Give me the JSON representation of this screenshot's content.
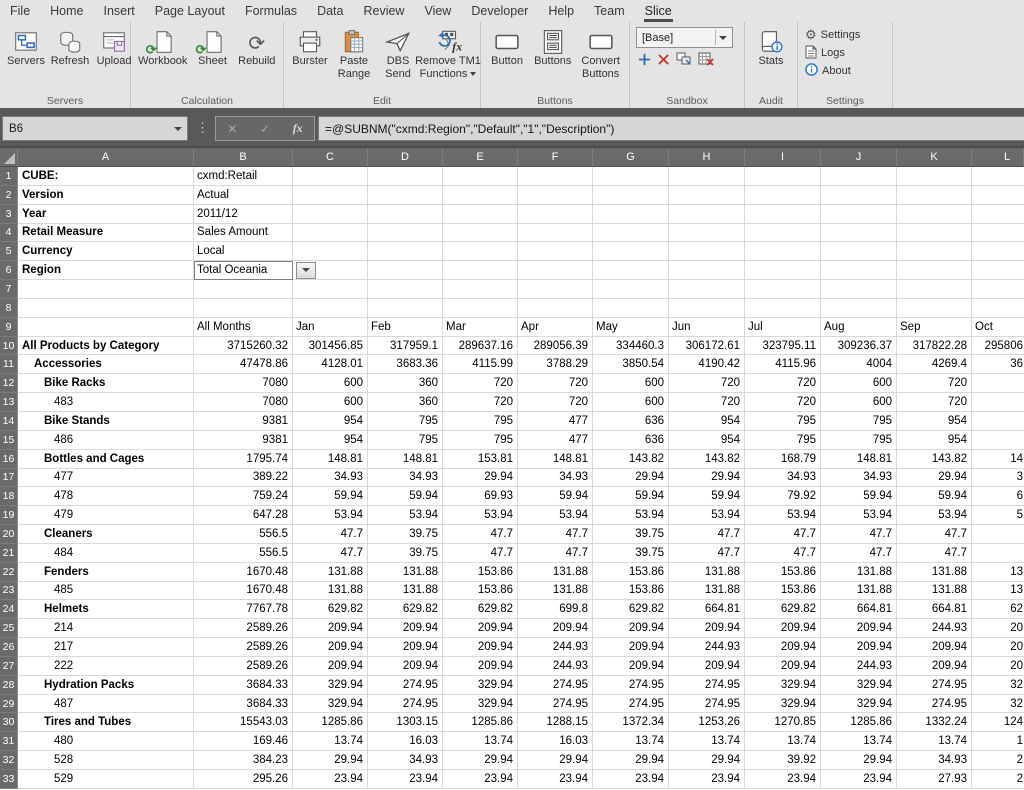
{
  "ribbon": {
    "tabs": [
      "File",
      "Home",
      "Insert",
      "Page Layout",
      "Formulas",
      "Data",
      "Review",
      "View",
      "Developer",
      "Help",
      "Team",
      "Slice"
    ],
    "active_tab": "Slice",
    "groups": {
      "servers": {
        "label": "Servers",
        "buttons": [
          {
            "label1": "Servers"
          },
          {
            "label1": "Refresh"
          },
          {
            "label1": "Upload"
          }
        ]
      },
      "calculation": {
        "label": "Calculation",
        "buttons": [
          {
            "label1": "Workbook"
          },
          {
            "label1": "Sheet"
          },
          {
            "label1": "Rebuild"
          }
        ]
      },
      "edit": {
        "label": "Edit",
        "buttons": [
          {
            "label1": "Burster"
          },
          {
            "label1": "Paste",
            "label2": "Range"
          },
          {
            "label1": "DBS",
            "label2": "Send"
          },
          {
            "label1": "Remove TM1",
            "label2": "Functions"
          }
        ]
      },
      "buttons": {
        "label": "Buttons",
        "buttons": [
          {
            "label1": "Button"
          },
          {
            "label1": "Buttons"
          },
          {
            "label1": "Convert",
            "label2": "Buttons"
          }
        ]
      },
      "sandbox": {
        "label": "Sandbox",
        "combo_value": "[Base]"
      },
      "audit": {
        "label": "Audit",
        "buttons": [
          {
            "label1": "Stats"
          }
        ]
      },
      "settings": {
        "label": "Settings",
        "items": [
          "Settings",
          "Logs",
          "About"
        ]
      }
    }
  },
  "formula_bar": {
    "name_box": "B6",
    "cancel_glyph": "✕",
    "enter_glyph": "✓",
    "fx_glyph": "fx",
    "handle_glyph": "⋮",
    "formula": "=@SUBNM(\"cxmd:Region\",\"Default\",\"1\",\"Description\")"
  },
  "icons": {
    "gear": "⚙",
    "rebuild": "⟳",
    "calc_badge": "⟳"
  },
  "grid": {
    "column_headers": [
      "A",
      "B",
      "C",
      "D",
      "E",
      "F",
      "G",
      "H",
      "I",
      "J",
      "K",
      "L"
    ],
    "rows": [
      {
        "n": 1,
        "type": "info",
        "label": "CUBE:",
        "value": "cxmd:Retail"
      },
      {
        "n": 2,
        "type": "info",
        "label": "Version",
        "value": "Actual"
      },
      {
        "n": 3,
        "type": "info",
        "label": "Year",
        "value": "2011/12"
      },
      {
        "n": 4,
        "type": "info",
        "label": "Retail Measure",
        "value": "Sales Amount"
      },
      {
        "n": 5,
        "type": "info",
        "label": "Currency",
        "value": "Local"
      },
      {
        "n": 6,
        "type": "info",
        "label": "Region",
        "value": "Total Oceania",
        "selected": true,
        "dropdown": true
      },
      {
        "n": 7,
        "type": "blank"
      },
      {
        "n": 8,
        "type": "blank"
      },
      {
        "n": 9,
        "type": "months",
        "cells": [
          "All Months",
          "Jan",
          "Feb",
          "Mar",
          "Apr",
          "May",
          "Jun",
          "Jul",
          "Aug",
          "Sep",
          "Oct"
        ]
      },
      {
        "n": 10,
        "type": "data",
        "label": "All Products by Category",
        "indent": 0,
        "bold": true,
        "values": [
          "3715260.32",
          "301456.85",
          "317959.1",
          "289637.16",
          "289056.39",
          "334460.3",
          "306172.61",
          "323795.11",
          "309236.37",
          "317822.28",
          "295806"
        ]
      },
      {
        "n": 11,
        "type": "data",
        "label": "Accessories",
        "indent": 1,
        "bold": true,
        "values": [
          "47478.86",
          "4128.01",
          "3683.36",
          "4115.99",
          "3788.29",
          "3850.54",
          "4190.42",
          "4115.96",
          "4004",
          "4269.4",
          "36"
        ]
      },
      {
        "n": 12,
        "type": "data",
        "label": "Bike Racks",
        "indent": 2,
        "bold": true,
        "values": [
          "7080",
          "600",
          "360",
          "720",
          "720",
          "600",
          "720",
          "720",
          "600",
          "720",
          ""
        ]
      },
      {
        "n": 13,
        "type": "data",
        "label": "483",
        "indent": 3,
        "bold": false,
        "values": [
          "7080",
          "600",
          "360",
          "720",
          "720",
          "600",
          "720",
          "720",
          "600",
          "720",
          ""
        ]
      },
      {
        "n": 14,
        "type": "data",
        "label": "Bike Stands",
        "indent": 2,
        "bold": true,
        "values": [
          "9381",
          "954",
          "795",
          "795",
          "477",
          "636",
          "954",
          "795",
          "795",
          "954",
          ""
        ]
      },
      {
        "n": 15,
        "type": "data",
        "label": "486",
        "indent": 3,
        "bold": false,
        "values": [
          "9381",
          "954",
          "795",
          "795",
          "477",
          "636",
          "954",
          "795",
          "795",
          "954",
          ""
        ]
      },
      {
        "n": 16,
        "type": "data",
        "label": "Bottles and Cages",
        "indent": 2,
        "bold": true,
        "values": [
          "1795.74",
          "148.81",
          "148.81",
          "153.81",
          "148.81",
          "143.82",
          "143.82",
          "168.79",
          "148.81",
          "143.82",
          "14"
        ]
      },
      {
        "n": 17,
        "type": "data",
        "label": "477",
        "indent": 3,
        "bold": false,
        "values": [
          "389.22",
          "34.93",
          "34.93",
          "29.94",
          "34.93",
          "29.94",
          "29.94",
          "34.93",
          "34.93",
          "29.94",
          "3"
        ]
      },
      {
        "n": 18,
        "type": "data",
        "label": "478",
        "indent": 3,
        "bold": false,
        "values": [
          "759.24",
          "59.94",
          "59.94",
          "69.93",
          "59.94",
          "59.94",
          "59.94",
          "79.92",
          "59.94",
          "59.94",
          "6"
        ]
      },
      {
        "n": 19,
        "type": "data",
        "label": "479",
        "indent": 3,
        "bold": false,
        "values": [
          "647.28",
          "53.94",
          "53.94",
          "53.94",
          "53.94",
          "53.94",
          "53.94",
          "53.94",
          "53.94",
          "53.94",
          "5"
        ]
      },
      {
        "n": 20,
        "type": "data",
        "label": "Cleaners",
        "indent": 2,
        "bold": true,
        "values": [
          "556.5",
          "47.7",
          "39.75",
          "47.7",
          "47.7",
          "39.75",
          "47.7",
          "47.7",
          "47.7",
          "47.7",
          ""
        ]
      },
      {
        "n": 21,
        "type": "data",
        "label": "484",
        "indent": 3,
        "bold": false,
        "values": [
          "556.5",
          "47.7",
          "39.75",
          "47.7",
          "47.7",
          "39.75",
          "47.7",
          "47.7",
          "47.7",
          "47.7",
          ""
        ]
      },
      {
        "n": 22,
        "type": "data",
        "label": "Fenders",
        "indent": 2,
        "bold": true,
        "values": [
          "1670.48",
          "131.88",
          "131.88",
          "153.86",
          "131.88",
          "153.86",
          "131.88",
          "153.86",
          "131.88",
          "131.88",
          "13"
        ]
      },
      {
        "n": 23,
        "type": "data",
        "label": "485",
        "indent": 3,
        "bold": false,
        "values": [
          "1670.48",
          "131.88",
          "131.88",
          "153.86",
          "131.88",
          "153.86",
          "131.88",
          "153.86",
          "131.88",
          "131.88",
          "13"
        ]
      },
      {
        "n": 24,
        "type": "data",
        "label": "Helmets",
        "indent": 2,
        "bold": true,
        "values": [
          "7767.78",
          "629.82",
          "629.82",
          "629.82",
          "699.8",
          "629.82",
          "664.81",
          "629.82",
          "664.81",
          "664.81",
          "62"
        ]
      },
      {
        "n": 25,
        "type": "data",
        "label": "214",
        "indent": 3,
        "bold": false,
        "values": [
          "2589.26",
          "209.94",
          "209.94",
          "209.94",
          "209.94",
          "209.94",
          "209.94",
          "209.94",
          "209.94",
          "244.93",
          "20"
        ]
      },
      {
        "n": 26,
        "type": "data",
        "label": "217",
        "indent": 3,
        "bold": false,
        "values": [
          "2589.26",
          "209.94",
          "209.94",
          "209.94",
          "244.93",
          "209.94",
          "244.93",
          "209.94",
          "209.94",
          "209.94",
          "20"
        ]
      },
      {
        "n": 27,
        "type": "data",
        "label": "222",
        "indent": 3,
        "bold": false,
        "values": [
          "2589.26",
          "209.94",
          "209.94",
          "209.94",
          "244.93",
          "209.94",
          "209.94",
          "209.94",
          "244.93",
          "209.94",
          "20"
        ]
      },
      {
        "n": 28,
        "type": "data",
        "label": "Hydration Packs",
        "indent": 2,
        "bold": true,
        "values": [
          "3684.33",
          "329.94",
          "274.95",
          "329.94",
          "274.95",
          "274.95",
          "274.95",
          "329.94",
          "329.94",
          "274.95",
          "32"
        ]
      },
      {
        "n": 29,
        "type": "data",
        "label": "487",
        "indent": 3,
        "bold": false,
        "values": [
          "3684.33",
          "329.94",
          "274.95",
          "329.94",
          "274.95",
          "274.95",
          "274.95",
          "329.94",
          "329.94",
          "274.95",
          "32"
        ]
      },
      {
        "n": 30,
        "type": "data",
        "label": "Tires and Tubes",
        "indent": 2,
        "bold": true,
        "values": [
          "15543.03",
          "1285.86",
          "1303.15",
          "1285.86",
          "1288.15",
          "1372.34",
          "1253.26",
          "1270.85",
          "1285.86",
          "1332.24",
          "124"
        ]
      },
      {
        "n": 31,
        "type": "data",
        "label": "480",
        "indent": 3,
        "bold": false,
        "values": [
          "169.46",
          "13.74",
          "16.03",
          "13.74",
          "16.03",
          "13.74",
          "13.74",
          "13.74",
          "13.74",
          "13.74",
          "1"
        ]
      },
      {
        "n": 32,
        "type": "data",
        "label": "528",
        "indent": 3,
        "bold": false,
        "values": [
          "384.23",
          "29.94",
          "34.93",
          "29.94",
          "29.94",
          "29.94",
          "29.94",
          "39.92",
          "29.94",
          "34.93",
          "2"
        ]
      },
      {
        "n": 33,
        "type": "data",
        "label": "529",
        "indent": 3,
        "bold": false,
        "values": [
          "295.26",
          "23.94",
          "23.94",
          "23.94",
          "23.94",
          "23.94",
          "23.94",
          "23.94",
          "23.94",
          "27.93",
          "2"
        ]
      }
    ]
  }
}
